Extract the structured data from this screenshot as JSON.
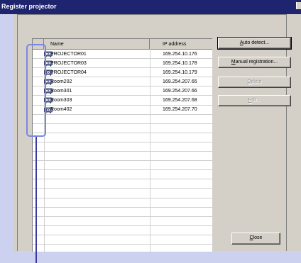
{
  "window": {
    "title": "Register projector"
  },
  "list": {
    "columns": {
      "name": "Name",
      "ip": "IP address"
    },
    "rows": [
      {
        "name": "PROJECTOR01",
        "ip": "169.254.10.176",
        "icon": "projector-connected-icon"
      },
      {
        "name": "PROJECTOR03",
        "ip": "169.254.10.178",
        "icon": "projector-connected-icon"
      },
      {
        "name": "PROJECTOR04",
        "ip": "169.254.10.179",
        "icon": "projector-standby-icon"
      },
      {
        "name": "Room202",
        "ip": "169.254.207.65",
        "icon": "projector-connected-icon"
      },
      {
        "name": "Room301",
        "ip": "169.254.207.66",
        "icon": "projector-connected-icon"
      },
      {
        "name": "Room303",
        "ip": "169.254.207.68",
        "icon": "projector-connected-icon"
      },
      {
        "name": "Room402",
        "ip": "169.254.207.70",
        "icon": "projector-standby-icon"
      }
    ]
  },
  "buttons": {
    "auto_detect": {
      "mnemonic": "A",
      "rest": "uto detect..."
    },
    "manual_registration": {
      "mnemonic": "M",
      "rest": "anual registration..."
    },
    "delete": {
      "mnemonic": "D",
      "rest": "elete"
    },
    "edit": {
      "mnemonic": "E",
      "rest": "dit..."
    },
    "close": {
      "mnemonic": "C",
      "rest": "lose"
    }
  },
  "colors": {
    "titlebar": "#1f246f",
    "highlight": "#7a86e6",
    "callout_line": "#3a3aa0"
  }
}
